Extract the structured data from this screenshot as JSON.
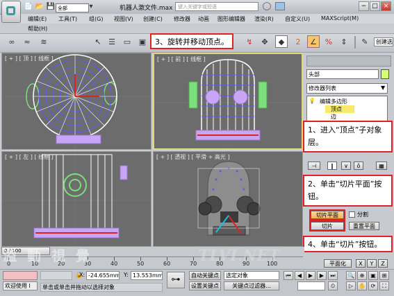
{
  "app": {
    "title": "机器人激文件.max",
    "search_placeholder": "键入关键字或短语",
    "win_min": "−",
    "win_max": "□",
    "win_close": "×"
  },
  "quick_access": [
    "📄",
    "📂",
    "💾",
    "↶",
    "↷",
    "▾"
  ],
  "menu": {
    "items": [
      "编辑(E)",
      "工具(T)",
      "组(G)",
      "视图(V)",
      "创建(C)",
      "修改器",
      "动画",
      "图形编辑器",
      "渲染(R)",
      "自定义(U)",
      "MAXScript(M)"
    ],
    "help": "帮助(H)"
  },
  "toolbar": {
    "selection_filter": "全部",
    "icons": [
      "link-icon",
      "unlink-icon",
      "bind-icon",
      "select-icon",
      "select-by-name-icon",
      "rect-select-icon",
      "window-crossing-icon",
      "move-icon"
    ],
    "right_icons": [
      "pivot-icon",
      "keyboard-shortcut-icon",
      "snap-2-icon",
      "angle-snap-icon",
      "percent-snap-icon",
      "spinner-snap-icon"
    ],
    "named_set": "创建选"
  },
  "callouts": {
    "c1": "1、进入“顶点”子对象层。",
    "c2": "2、单击“切片平面”按钮。",
    "c3": "3、旋转并移动顶点。",
    "c4": "4、单击“切片”按钮。"
  },
  "viewports": {
    "top": "[ + ] [ 顶 ] [ 线框 ]",
    "front": "[ + ] [ 前 ] [ 线框 ]",
    "left": "[ + ] [ 左 ] [ 线框 ]",
    "persp": "[ + ] [ 透视 ] [ 平滑 + 高光 ]"
  },
  "command_panel": {
    "object_name": "头部",
    "object_color": "#d6ff77",
    "modifier_list": "修改器列表",
    "stack": [
      "编辑多边形",
      "顶点",
      "边"
    ],
    "slice_plane": "切片平面",
    "split": "分割",
    "slice": "切片",
    "reset_plane": "重置平面",
    "planarize": "平面化",
    "xyz": [
      "X",
      "Y",
      "Z"
    ]
  },
  "timeline": {
    "frame": "0 / 100",
    "ticks": [
      "0",
      "10",
      "20",
      "30",
      "40",
      "50",
      "60",
      "70",
      "80",
      "90",
      "100"
    ]
  },
  "status": {
    "welcome": "欢迎使用 I",
    "prompt": "单击或单击并拖动以选择对象",
    "x_label": "X:",
    "x_value": "-24.655mm",
    "y_label": "Y:",
    "y_value": "13.553mm",
    "auto_key": "自动关键点",
    "set_key": "设置关键点",
    "key_mode": "选定对象",
    "key_filters": "关键点过滤器..."
  },
  "watermark": "TLVI.NET",
  "watermark_cn": "溢 動 視 覺"
}
